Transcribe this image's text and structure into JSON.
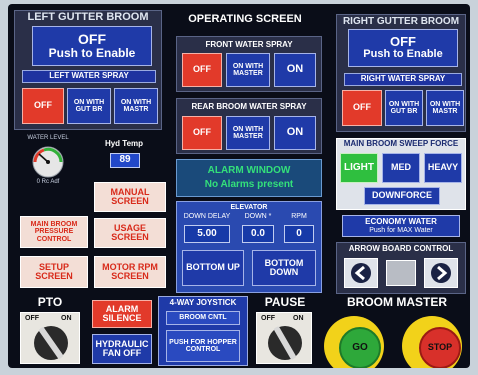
{
  "left_gutter": {
    "title": "LEFT GUTTER BROOM",
    "main_line1": "OFF",
    "main_line2": "Push to Enable",
    "spray_title": "LEFT WATER SPRAY",
    "btn_off": "OFF",
    "btn_gut": "ON WITH GUT BR",
    "btn_mastr": "ON WITH MASTR"
  },
  "right_gutter": {
    "title": "RIGHT GUTTER BROOM",
    "main_line1": "OFF",
    "main_line2": "Push to Enable",
    "spray_title": "RIGHT WATER SPRAY",
    "btn_off": "OFF",
    "btn_gut": "ON WITH GUT BR",
    "btn_mastr": "ON WITH MASTR"
  },
  "operating": {
    "title": "OPERATING SCREEN",
    "front_title": "FRONT WATER SPRAY",
    "rear_title": "REAR BROOM WATER SPRAY",
    "btn_off": "OFF",
    "btn_master": "ON WITH MASTER",
    "btn_on": "ON"
  },
  "alarm": {
    "title": "ALARM WINDOW",
    "status": "No Alarms present"
  },
  "elevator": {
    "title": "ELEVATOR",
    "col_delay": "DOWN DELAY",
    "col_down": "DOWN *",
    "col_rpm": "RPM",
    "delay_value": "5.00",
    "down_value": "0.0",
    "rpm_value": "0",
    "btn_up": "BOTTOM UP",
    "btn_down": "BOTTOM DOWN"
  },
  "water_level": {
    "label": "WATER LEVEL",
    "sublabel": "0 Rc Adf"
  },
  "hyd_temp": {
    "label": "Hyd Temp",
    "value": "89"
  },
  "nav": {
    "manual": "MANUAL SCREEN",
    "main_broom_pressure": "MAIN BROOM PRESSURE CONTROL",
    "usage": "USAGE SCREEN",
    "setup": "SETUP SCREEN",
    "motor_rpm": "MOTOR RPM SCREEN"
  },
  "sweep_force": {
    "title": "MAIN BROOM SWEEP FORCE",
    "light": "LIGHT",
    "med": "MED",
    "heavy": "HEAVY",
    "downforce": "DOWNFORCE"
  },
  "economy": {
    "title": "ECONOMY WATER",
    "subtitle": "Push for MAX Water"
  },
  "arrow_board": {
    "title": "ARROW BOARD CONTROL"
  },
  "pto": {
    "title": "PTO",
    "off": "OFF",
    "on": "ON"
  },
  "alarm_silence": "ALARM SILENCE",
  "hydraulic_fan": "HYDRAULIC FAN OFF",
  "joystick": {
    "title": "4-WAY JOYSTICK",
    "btn_cntl": "BROOM CNTL",
    "btn_hopper": "PUSH FOR HOPPER CONTROL"
  },
  "pause": {
    "title": "PAUSE",
    "off": "OFF",
    "on": "ON"
  },
  "broom_master": {
    "title": "BROOM MASTER",
    "go": "GO",
    "stop": "STOP"
  },
  "colors": {
    "screen_bg": "#0a0d18",
    "button_blue": "#1f3aa8",
    "button_red": "#e23a2a",
    "alarm_green": "#33e07a",
    "go_green": "#2ea83a",
    "stop_red": "#d8302a",
    "ring_yellow": "#f2d21a"
  }
}
